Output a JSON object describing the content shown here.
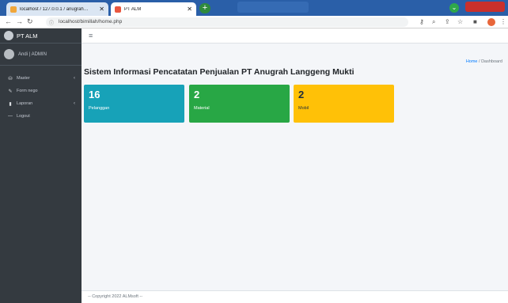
{
  "browser": {
    "tabs": [
      {
        "label": "localhost / 127.0.0.1 / anugrah…"
      },
      {
        "label": "PT ALM"
      }
    ],
    "url": "localhost/bimillah/home.php"
  },
  "sidebar": {
    "brand": "PT ALM",
    "user": "Andi | ADMIN",
    "items": [
      {
        "label": "Master",
        "icon": "database-icon"
      },
      {
        "label": "Form nego",
        "icon": "edit-icon"
      },
      {
        "label": "Laporan",
        "icon": "book-icon"
      },
      {
        "label": "Logout",
        "icon": "logout-icon"
      }
    ]
  },
  "header": {
    "title": "Sistem Informasi Pencatatan Penjualan PT Anugrah Langgeng Mukti",
    "breadcrumb": {
      "home": "Home",
      "separator": "/",
      "current": "Dashboard"
    }
  },
  "stats": [
    {
      "value": "16",
      "label": "Pelanggan",
      "color": "#17a2b8"
    },
    {
      "value": "2",
      "label": "Material",
      "color": "#28a745"
    },
    {
      "value": "2",
      "label": "Mobil",
      "color": "#ffc107"
    }
  ],
  "footer": {
    "text": "-- Copyright 2022 ALMsoft --"
  }
}
